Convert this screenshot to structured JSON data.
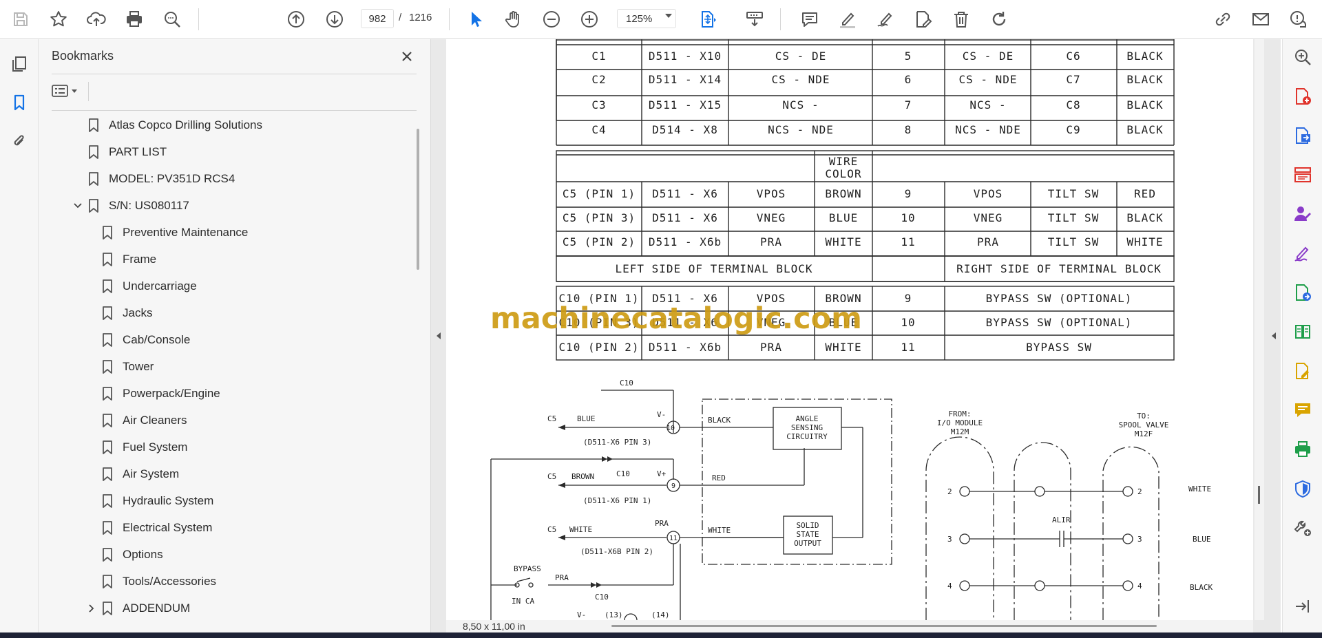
{
  "toolbar": {
    "page_current": "982",
    "page_separator": "/",
    "page_total": "1216",
    "zoom": "125%",
    "icons": [
      "save-icon",
      "star-icon",
      "upload-icon",
      "print-icon",
      "zoom-search-icon",
      "page-up-icon",
      "page-down-icon",
      "select-cursor-icon",
      "hand-icon",
      "zoom-out-icon",
      "zoom-in-icon",
      "fit-page-icon",
      "scroll-mode-icon",
      "comment-icon",
      "highlight-icon",
      "sign-icon",
      "edit-pdf-icon",
      "delete-icon",
      "rotate-icon",
      "share-link-icon",
      "mail-icon",
      "account-help-icon"
    ],
    "accent": "#1473e6"
  },
  "left_rail": {
    "icons": [
      "page-thumbnails-icon",
      "bookmarks-icon",
      "attachments-icon"
    ]
  },
  "bookmarks": {
    "title": "Bookmarks",
    "items": [
      {
        "label": "Atlas Copco Drilling Solutions",
        "level": 0,
        "expander": ""
      },
      {
        "label": "PART LIST",
        "level": 0,
        "expander": ""
      },
      {
        "label": "MODEL: PV351D RCS4",
        "level": 0,
        "expander": ""
      },
      {
        "label": "S/N: US080117",
        "level": 0,
        "expander": "expanded"
      },
      {
        "label": "Preventive Maintenance",
        "level": 1,
        "expander": ""
      },
      {
        "label": "Frame",
        "level": 1,
        "expander": ""
      },
      {
        "label": "Undercarriage",
        "level": 1,
        "expander": ""
      },
      {
        "label": "Jacks",
        "level": 1,
        "expander": ""
      },
      {
        "label": "Cab/Console",
        "level": 1,
        "expander": ""
      },
      {
        "label": "Tower",
        "level": 1,
        "expander": ""
      },
      {
        "label": "Powerpack/Engine",
        "level": 1,
        "expander": ""
      },
      {
        "label": "Air Cleaners",
        "level": 1,
        "expander": ""
      },
      {
        "label": "Fuel System",
        "level": 1,
        "expander": ""
      },
      {
        "label": "Air System",
        "level": 1,
        "expander": ""
      },
      {
        "label": "Hydraulic System",
        "level": 1,
        "expander": ""
      },
      {
        "label": "Electrical System",
        "level": 1,
        "expander": ""
      },
      {
        "label": "Options",
        "level": 1,
        "expander": ""
      },
      {
        "label": "Tools/Accessories",
        "level": 1,
        "expander": ""
      },
      {
        "label": "ADDENDUM",
        "level": 1,
        "expander": "collapsed"
      }
    ]
  },
  "document": {
    "page_size": "8,50 x 11,00 in",
    "watermark": "machinecatalogic.com",
    "table_rows_top": [
      [
        "C1",
        "D511 - X10",
        "CS - DE",
        "5",
        "CS - DE",
        "C6",
        "BLACK"
      ],
      [
        "C2",
        "D511 - X14",
        "CS - NDE",
        "6",
        "CS - NDE",
        "C7",
        "BLACK"
      ],
      [
        "C3",
        "D511 - X15",
        "NCS -",
        "7",
        "NCS -",
        "C8",
        "BLACK"
      ],
      [
        "C4",
        "D514 - X8",
        "NCS - NDE",
        "8",
        "NCS - NDE",
        "C9",
        "BLACK"
      ]
    ],
    "wire_color_header": [
      "WIRE",
      "COLOR"
    ],
    "table_rows_mid": [
      [
        "C5 (PIN 1)",
        "D511 - X6",
        "VPOS",
        "BROWN",
        "9",
        "VPOS",
        "TILT SW",
        "RED"
      ],
      [
        "C5 (PIN 3)",
        "D511 - X6",
        "VNEG",
        "BLUE",
        "10",
        "VNEG",
        "TILT SW",
        "BLACK"
      ],
      [
        "C5 (PIN 2)",
        "D511 - X6b",
        "PRA",
        "WHITE",
        "11",
        "PRA",
        "TILT SW",
        "WHITE"
      ]
    ],
    "left_side_label": "LEFT SIDE OF TERMINAL BLOCK",
    "right_side_label": "RIGHT SIDE OF TERMINAL BLOCK",
    "table_rows_bottom": [
      [
        "C10 (PIN 1)",
        "D511 - X6",
        "VPOS",
        "BROWN",
        "9",
        "BYPASS SW (OPTIONAL)"
      ],
      [
        "C10 (PIN 3)",
        "D511 - X6",
        "VNEG",
        "BLUE",
        "10",
        "BYPASS SW (OPTIONAL)"
      ],
      [
        "C10 (PIN 2)",
        "D511 - X6b",
        "PRA",
        "WHITE",
        "11",
        "BYPASS SW"
      ]
    ],
    "schematic": {
      "c10_top": "C10",
      "c5_blue": "C5",
      "blue": "BLUE",
      "v_minus": "V-",
      "d511_pin3": "(D511-X6   PIN 3)",
      "c5_brown": "C5",
      "brown": "BROWN",
      "c10_mid": "C10",
      "v_plus": "V+",
      "d511_pin1": "(D511-X6   PIN 1)",
      "c5_white": "C5",
      "white": "WHITE",
      "pra": "PRA",
      "d511_pin2": "(D511-X6B   PIN 2)",
      "bypass": "BYPASS",
      "in_ca": "IN CA",
      "pra2": "PRA",
      "c10_low": "C10",
      "v_minus_low": "V-",
      "n13": "(13)",
      "n14": "(14)",
      "t10": "10",
      "t9": "9",
      "t11": "11",
      "black": "BLACK",
      "red": "RED",
      "white2": "WHITE",
      "angle_box": [
        "ANGLE",
        "SENSING",
        "CIRCUITRY"
      ],
      "solid_box": [
        "SOLID",
        "STATE",
        "OUTPUT"
      ],
      "from_label": [
        "FROM:",
        "I/O MODULE",
        "M12M"
      ],
      "to_label": [
        "TO:",
        "SPOOL VALVE",
        "M12F"
      ],
      "pin2": "2",
      "pin3": "3",
      "pin4": "4",
      "alir": "ALIR",
      "w_white": "WHITE",
      "w_blue": "BLUE",
      "w_black": "BLACK"
    }
  },
  "right_rail": {
    "icons": [
      "zoom-tool-icon",
      "export-pdf-icon",
      "create-pdf-icon",
      "organize-pages-icon",
      "request-signature-icon",
      "fill-sign-icon",
      "export-pdf-icon-2",
      "compare-icon",
      "edit-pdf-icon",
      "comment-tool-icon",
      "print-production-icon",
      "protect-icon",
      "more-tools-icon",
      "expand-panel-icon"
    ],
    "colors": {
      "red": "#e0342c",
      "blue": "#2d6be0",
      "purple": "#8a3cc9",
      "green": "#1e9e4a",
      "yellow": "#d9a400",
      "gray": "#555555"
    }
  }
}
